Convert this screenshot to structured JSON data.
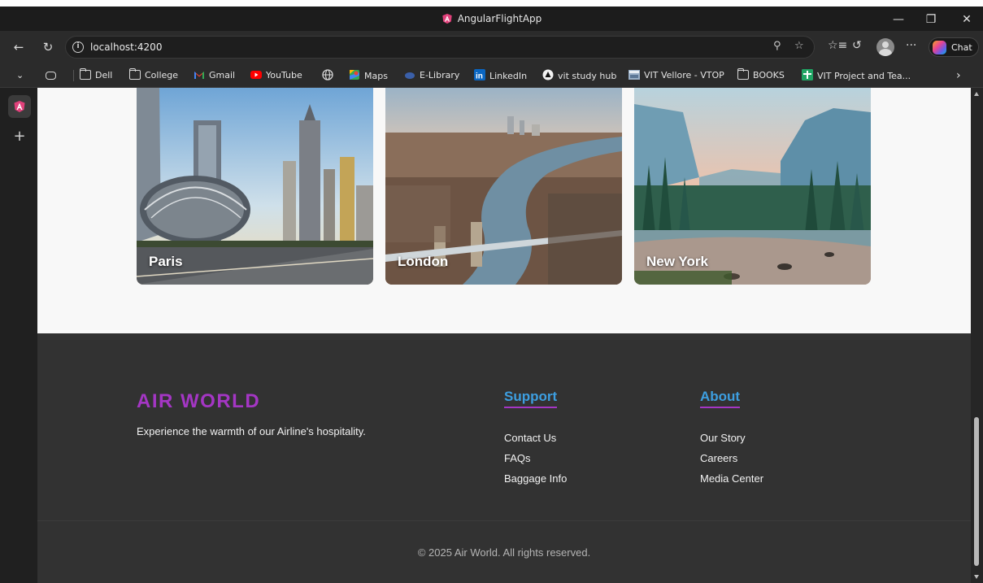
{
  "window": {
    "title": "AngularFlightApp",
    "controls": [
      "minimize-icon",
      "restore-icon",
      "close-icon"
    ]
  },
  "addressbar": {
    "url": "localhost:4200",
    "chat_label": "Chat",
    "more_label": "···"
  },
  "bookmarks": [
    {
      "label": "Dell",
      "icon": "folder-icon"
    },
    {
      "label": "College",
      "icon": "folder-icon"
    },
    {
      "label": "Gmail",
      "icon": "gmail-icon"
    },
    {
      "label": "YouTube",
      "icon": "youtube-icon"
    },
    {
      "label": "",
      "icon": "globe-icon"
    },
    {
      "label": "Maps",
      "icon": "maps-icon"
    },
    {
      "label": "E-Library",
      "icon": "library-icon"
    },
    {
      "label": "LinkedIn",
      "icon": "linkedin-icon"
    },
    {
      "label": "vit study hub",
      "icon": "study-hub-icon"
    },
    {
      "label": "VIT Vellore - VTOP",
      "icon": "vtop-icon"
    },
    {
      "label": "BOOKS",
      "icon": "folder-icon"
    },
    {
      "label": "VIT Project and Tea...",
      "icon": "sheets-icon"
    }
  ],
  "destinations": [
    {
      "name": "Paris"
    },
    {
      "name": "London"
    },
    {
      "name": "New York"
    }
  ],
  "footer": {
    "brand": "AIR WORLD",
    "tagline": "Experience the warmth of our Airline's hospitality.",
    "support": {
      "heading": "Support",
      "links": [
        "Contact Us",
        "FAQs",
        "Baggage Info"
      ]
    },
    "about": {
      "heading": "About",
      "links": [
        "Our Story",
        "Careers",
        "Media Center"
      ]
    },
    "copyright": "© 2025 Air World. All rights reserved."
  },
  "colors": {
    "brand_purple": "#a436c4",
    "heading_blue": "#3d9ee0",
    "footer_bg": "#323232",
    "page_bg": "#f8f8f8"
  }
}
